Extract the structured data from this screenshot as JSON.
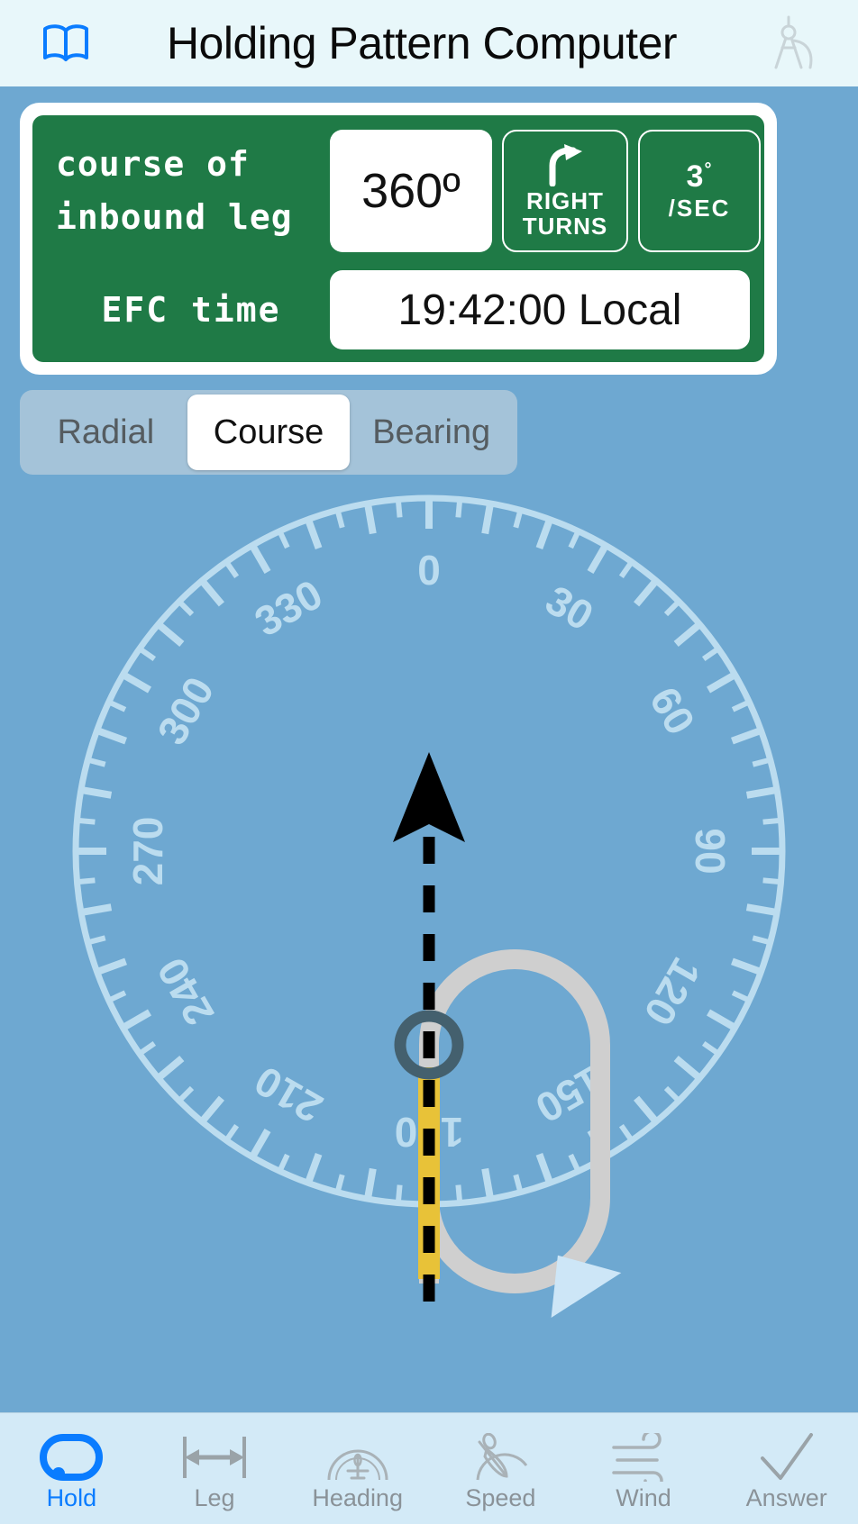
{
  "header": {
    "title": "Holding Pattern Computer",
    "left_icon": "book-icon",
    "right_icon": "drafting-compass-icon"
  },
  "card": {
    "course_label_line1": "course of",
    "course_label_line2": "inbound leg",
    "course_value": "360º",
    "turns_icon": "curved-right-arrow-icon",
    "turns_label_line1": "RIGHT",
    "turns_label_line2": "TURNS",
    "rate_value": "3",
    "rate_degree": "°",
    "rate_unit": "/SEC",
    "efc_label": "EFC time",
    "efc_value": "19:42:00 Local"
  },
  "segmented": {
    "options": [
      "Radial",
      "Course",
      "Bearing"
    ],
    "selected": "Course"
  },
  "compass": {
    "labels": [
      "0",
      "30",
      "60",
      "90",
      "120",
      "150",
      "180",
      "210",
      "240",
      "270",
      "300",
      "330"
    ],
    "ring_color": "#BBDCEF",
    "background_color": "#6EA8D1",
    "heading_arrow_color": "#000000",
    "inbound_leg_color": "#E8C238",
    "pattern_track_color": "#CFCFCF",
    "fix_marker_color": "#44606E",
    "aircraft_color": "#CDE6F7",
    "turn_direction": "right",
    "inbound_course_deg": 360
  },
  "tabs": [
    {
      "label": "Hold",
      "icon": "racetrack-hold-icon",
      "active": true
    },
    {
      "label": "Leg",
      "icon": "leg-length-arrow-icon",
      "active": false
    },
    {
      "label": "Heading",
      "icon": "heading-indicator-icon",
      "active": false
    },
    {
      "label": "Speed",
      "icon": "airspeed-needle-icon",
      "active": false
    },
    {
      "label": "Wind",
      "icon": "wind-lines-icon",
      "active": false
    },
    {
      "label": "Answer",
      "icon": "checkmark-icon",
      "active": false
    }
  ],
  "colors": {
    "accent": "#0A7CFF",
    "card_green": "#1F7A46",
    "header_bg": "#E8F7FA",
    "tabbar_bg": "#D3EAF7",
    "body_bg": "#6EA8D1",
    "segment_bg": "#A4C3D9"
  }
}
